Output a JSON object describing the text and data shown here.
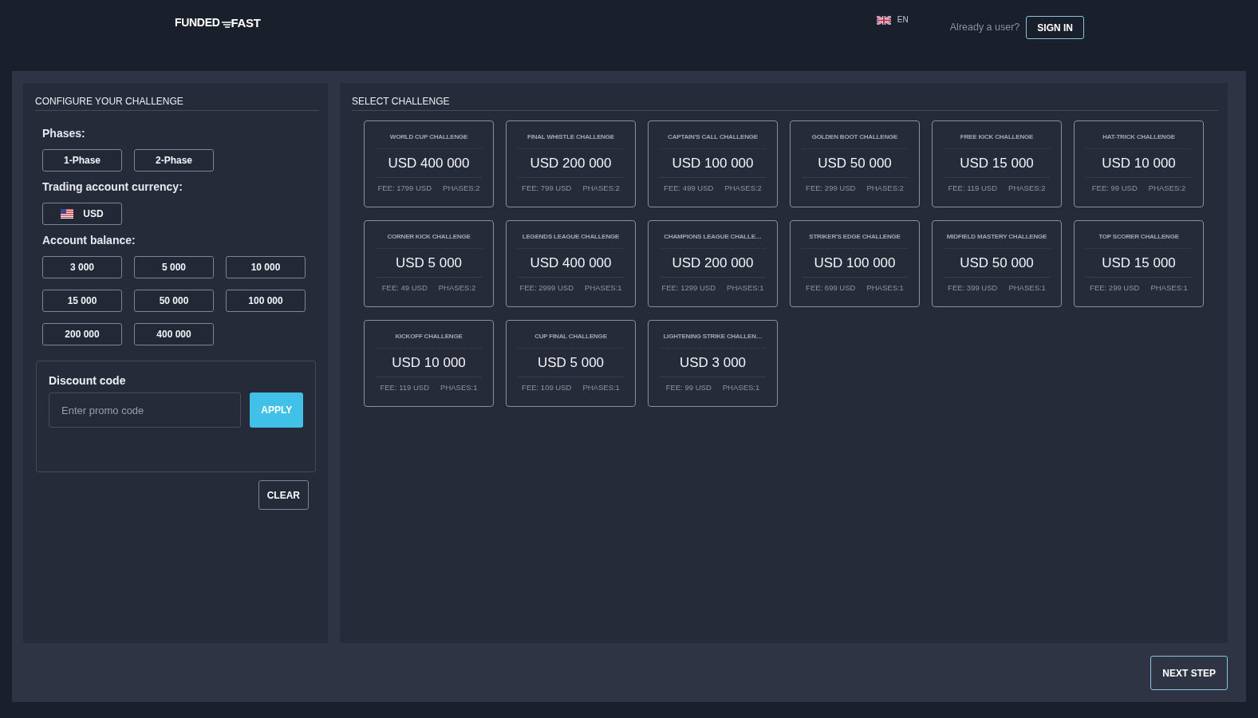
{
  "header": {
    "logo": {
      "text_1": "FUNDED",
      "text_2": "FAST"
    },
    "language": {
      "code": "EN"
    },
    "prompt": "Already a user?",
    "sign_in_button": "SIGN IN"
  },
  "configure_panel": {
    "title": "CONFIGURE YOUR CHALLENGE",
    "phases": {
      "label": "Phases:",
      "options": [
        {
          "label": "1-Phase",
          "selected": false
        },
        {
          "label": "2-Phase",
          "selected": false
        }
      ]
    },
    "currency": {
      "label": "Trading account currency:",
      "options": [
        {
          "label": "USD",
          "selected": false
        }
      ]
    },
    "balance": {
      "label": "Account balance:",
      "options": [
        {
          "label": "3 000",
          "selected": false
        },
        {
          "label": "5 000",
          "selected": false
        },
        {
          "label": "10 000",
          "selected": false
        },
        {
          "label": "15 000",
          "selected": false
        },
        {
          "label": "50 000",
          "selected": false
        },
        {
          "label": "100 000",
          "selected": false
        },
        {
          "label": "200 000",
          "selected": false
        },
        {
          "label": "400 000",
          "selected": false
        }
      ]
    },
    "discount": {
      "title": "Discount code",
      "placeholder": "Enter promo code",
      "apply_button": "APPLY"
    },
    "clear_button": "CLEAR"
  },
  "challenge_panel": {
    "title": "SELECT CHALLENGE",
    "challenges": [
      {
        "name": "WORLD CUP CHALLENGE",
        "amount": "USD 400 000",
        "fee": "FEE: 1799 USD",
        "phases": "PHASES:2",
        "selected": false
      },
      {
        "name": "FINAL WHISTLE CHALLENGE",
        "amount": "USD 200 000",
        "fee": "FEE: 799 USD",
        "phases": "PHASES:2",
        "selected": false
      },
      {
        "name": "CAPTAIN'S CALL CHALLENGE",
        "amount": "USD 100 000",
        "fee": "FEE: 499 USD",
        "phases": "PHASES:2",
        "selected": false
      },
      {
        "name": "GOLDEN BOOT CHALLENGE",
        "amount": "USD 50 000",
        "fee": "FEE: 299 USD",
        "phases": "PHASES:2",
        "selected": false
      },
      {
        "name": "FREE KICK CHALLENGE",
        "amount": "USD 15 000",
        "fee": "FEE: 119 USD",
        "phases": "PHASES:2",
        "selected": false
      },
      {
        "name": "HAT-TRICK CHALLENGE",
        "amount": "USD 10 000",
        "fee": "FEE: 99 USD",
        "phases": "PHASES:2",
        "selected": false
      },
      {
        "name": "CORNER KICK CHALLENGE",
        "amount": "USD 5 000",
        "fee": "FEE: 49 USD",
        "phases": "PHASES:2",
        "selected": false
      },
      {
        "name": "LEGENDS LEAGUE CHALLENGE",
        "amount": "USD 400 000",
        "fee": "FEE: 2999 USD",
        "phases": "PHASES:1",
        "selected": false
      },
      {
        "name": "CHAMPIONS LEAGUE CHALLE…",
        "amount": "USD 200 000",
        "fee": "FEE: 1299 USD",
        "phases": "PHASES:1",
        "selected": false
      },
      {
        "name": "STRIKER'S EDGE CHALLENGE",
        "amount": "USD 100 000",
        "fee": "FEE: 699 USD",
        "phases": "PHASES:1",
        "selected": false
      },
      {
        "name": "MIDFIELD MASTERY CHALLENGE",
        "amount": "USD 50 000",
        "fee": "FEE: 399 USD",
        "phases": "PHASES:1",
        "selected": false
      },
      {
        "name": "TOP SCORER CHALLENGE",
        "amount": "USD 15 000",
        "fee": "FEE: 299 USD",
        "phases": "PHASES:1",
        "selected": false
      },
      {
        "name": "KICKOFF CHALLENGE",
        "amount": "USD 10 000",
        "fee": "FEE: 119 USD",
        "phases": "PHASES:1",
        "selected": false
      },
      {
        "name": "CUP FINAL CHALLENGE",
        "amount": "USD 5 000",
        "fee": "FEE: 109 USD",
        "phases": "PHASES:1",
        "selected": false
      },
      {
        "name": "LIGHTENING STRIKE CHALLEN…",
        "amount": "USD 3 000",
        "fee": "FEE: 99 USD",
        "phases": "PHASES:1",
        "selected": false
      }
    ]
  },
  "next_button": "NEXT STEP"
}
